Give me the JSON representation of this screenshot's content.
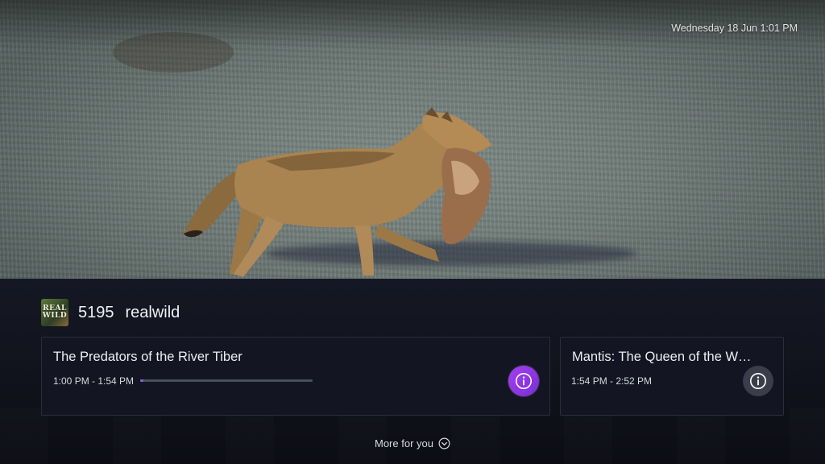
{
  "clock": {
    "text": "Wednesday 18 Jun 1:01 PM"
  },
  "channel": {
    "logo_text": "REAL WILD",
    "number": "5195",
    "name": "realwild"
  },
  "current_program": {
    "title": "The Predators of the River Tiber",
    "time": "1:00 PM - 1:54 PM",
    "progress_fraction": 0.02,
    "info_icon": "info-icon"
  },
  "next_program": {
    "title": "Mantis: The Queen of the W…",
    "time": "1:54 PM - 2:52 PM",
    "info_icon": "info-icon"
  },
  "more_for_you": {
    "label": "More for you",
    "icon": "chevron-down-circle-icon"
  },
  "colors": {
    "accent": "#8a5cf0",
    "info_active": "#a43ef0",
    "info_inactive": "#3b3e4a",
    "overlay_bg": "#151824"
  }
}
